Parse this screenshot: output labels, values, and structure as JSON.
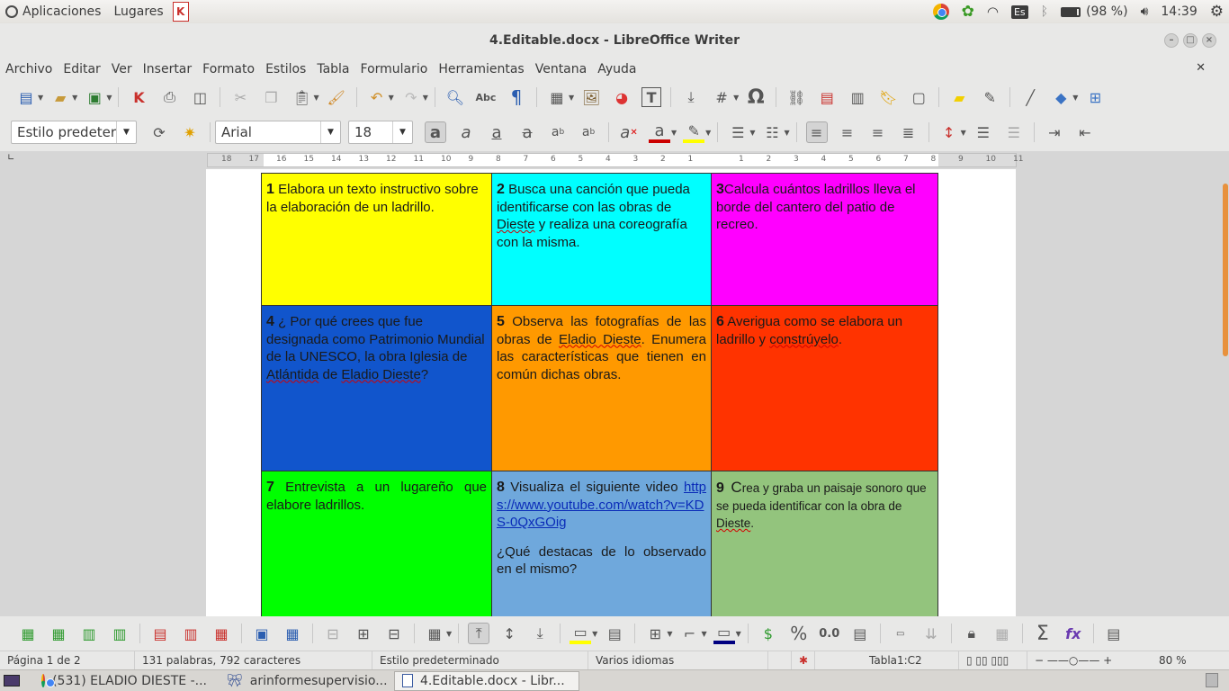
{
  "top_panel": {
    "apps_label": "Aplicaciones",
    "places_label": "Lugares",
    "keyboard_layout": "Es",
    "battery": "(98 %)",
    "clock": "14:39"
  },
  "window": {
    "title": "4.Editable.docx - LibreOffice Writer"
  },
  "menu": [
    "Archivo",
    "Editar",
    "Ver",
    "Insertar",
    "Formato",
    "Estilos",
    "Tabla",
    "Formulario",
    "Herramientas",
    "Ventana",
    "Ayuda"
  ],
  "formatting": {
    "paragraph_style": "Estilo predeter",
    "font_name": "Arial",
    "font_size": "18"
  },
  "ruler": [
    "18",
    "17",
    "16",
    "15",
    "14",
    "13",
    "12",
    "11",
    "10",
    "9",
    "8",
    "7",
    "6",
    "5",
    "4",
    "3",
    "2",
    "1",
    "1",
    "2",
    "3",
    "4",
    "5",
    "6",
    "7",
    "8",
    "9",
    "10",
    "11"
  ],
  "cells": [
    {
      "num": "1",
      "color": "#ffff00",
      "text": " Elabora un texto instructivo sobre la elaboración de un ladrillo."
    },
    {
      "num": "2",
      "color": "#00ffff",
      "pre": " Busca una canción que pueda identificarse con las obras de ",
      "spell": "Dieste",
      "post": " y realiza una coreografía con la misma."
    },
    {
      "num": "3",
      "color": "#ff00ff",
      "text": "Calcula cuántos ladrillos lleva el borde del cantero del patio de recreo."
    },
    {
      "num": "4",
      "color": "#1155cc",
      "pre": "  ¿ Por qué crees que fue designada como Patrimonio Mundial de la UNESCO, la obra Iglesia de ",
      "spell1": "Atlántida",
      "mid": " de ",
      "spell2": "Eladio Dieste",
      "post": "?"
    },
    {
      "num": "5",
      "color": "#ff9900",
      "pre": " Observa  las fotografías de las obras de ",
      "spell": "Eladio Dieste",
      "post": ". Enumera las características que tienen en común dichas obras."
    },
    {
      "num": "6",
      "color": "#ff3300",
      "pre": " Averigua como se elabora un ladrillo y ",
      "spell": "constrúyelo",
      "post": "."
    },
    {
      "num": "7",
      "color": "#00ff00",
      "text": "  Entrevista a un lugareño que elabore ladrillos."
    },
    {
      "num": "8",
      "color": "#6fa8dc",
      "pre": " Visualiza el siguiente video ",
      "link": "https://www.youtube.com/watch?v=KDS-0QxGOig",
      "question": "¿Qué destacas de lo observado en el mismo?"
    },
    {
      "num": "9",
      "color": "#93c47d",
      "cap": "C",
      "pre": "rea y graba un paisaje sonoro que se pueda identificar con la obra de ",
      "spell": "Dieste",
      "post": "."
    }
  ],
  "statusbar": {
    "page": "Página 1 de 2",
    "words": "131 palabras, 792 caracteres",
    "style": "Estilo predeterminado",
    "language": "Varios idiomas",
    "cell": "Tabla1:C2",
    "zoom": "80 %"
  },
  "taskbar": [
    {
      "label": "(531) ELADIO DIESTE -..."
    },
    {
      "label": "arinformesupervisio..."
    },
    {
      "label": "4.Editable.docx - Libr..."
    }
  ]
}
